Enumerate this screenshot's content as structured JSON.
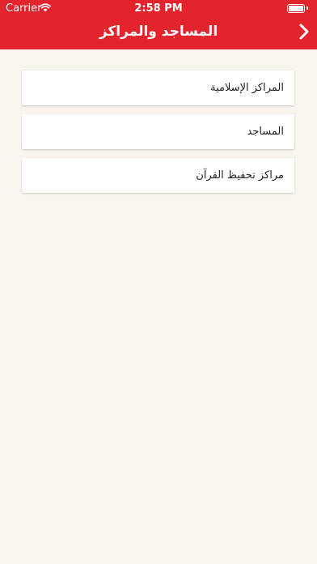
{
  "status_bar": {
    "carrier": "Carrier",
    "time": "2:58 PM"
  },
  "header": {
    "title": "المساجد والمراكز",
    "back_icon": "chevron-right-icon"
  },
  "list": {
    "items": [
      {
        "label": "المراكز الإسلامية"
      },
      {
        "label": "المساجد"
      },
      {
        "label": "مراكز تحفيظ القرآن"
      }
    ]
  },
  "colors": {
    "header": "#e4242d",
    "background": "#f8f5ee",
    "card": "#ffffff"
  }
}
